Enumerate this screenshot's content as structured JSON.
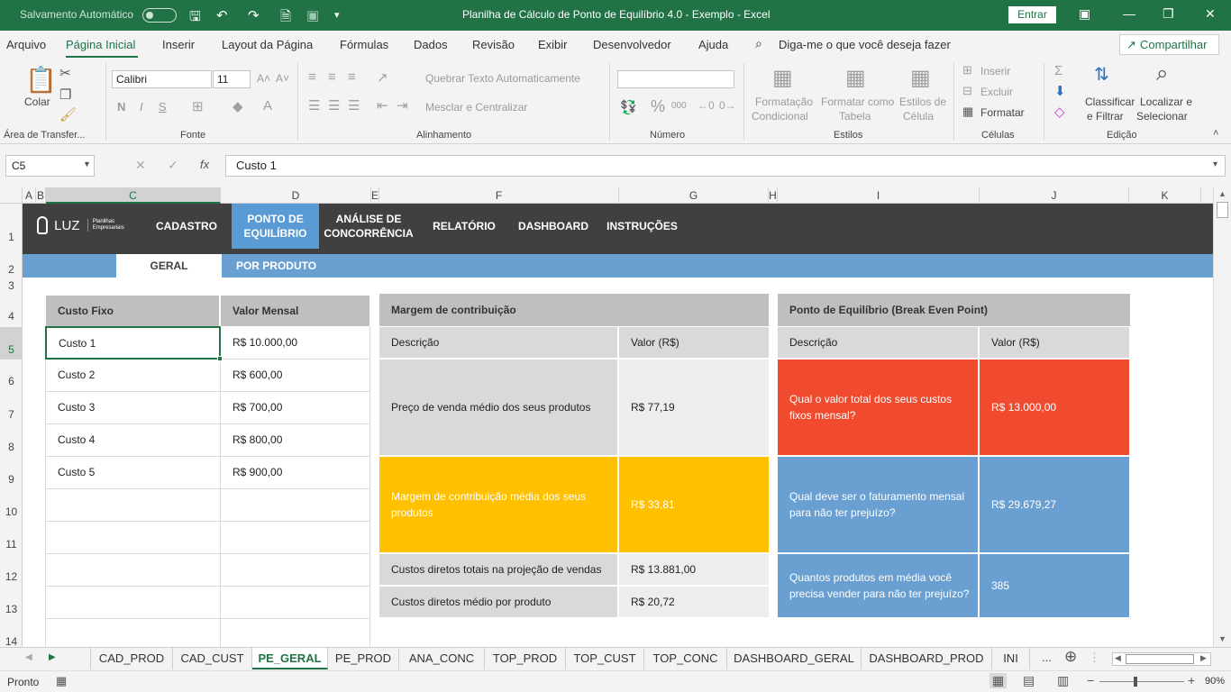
{
  "window": {
    "autosave_label": "Salvamento Automático",
    "title": "Planilha de Cálculo de Ponto de Equilíbrio 4.0 - Exemplo  -  Excel",
    "signin": "Entrar"
  },
  "menu": {
    "items": [
      "Arquivo",
      "Página Inicial",
      "Inserir",
      "Layout da Página",
      "Fórmulas",
      "Dados",
      "Revisão",
      "Exibir",
      "Desenvolvedor",
      "Ajuda"
    ],
    "tellme": "Diga-me o que você deseja fazer",
    "share": "Compartilhar"
  },
  "ribbon": {
    "paste": "Colar",
    "clipboard": "Área de Transfer...",
    "font_name": "Calibri",
    "font_size": "11",
    "font_group": "Fonte",
    "bold": "N",
    "italic": "I",
    "underline": "S",
    "wrap": "Quebrar Texto Automaticamente",
    "merge": "Mesclar e Centralizar",
    "alignment": "Alinhamento",
    "percent": "%",
    "thousands": "000",
    "number": "Número",
    "cond_format": [
      "Formatação",
      "Condicional"
    ],
    "format_table": [
      "Formatar como",
      "Tabela"
    ],
    "cell_styles": [
      "Estilos de",
      "Célula"
    ],
    "styles": "Estilos",
    "insert": "Inserir",
    "delete": "Excluir",
    "format": "Formatar",
    "cells": "Células",
    "sort": [
      "Classificar",
      "e Filtrar"
    ],
    "find": [
      "Localizar e",
      "Selecionar"
    ],
    "editing": "Edição"
  },
  "formula_bar": {
    "name_box": "C5",
    "content": "Custo 1"
  },
  "columns": [
    "A",
    "B",
    "C",
    "D",
    "E",
    "F",
    "G",
    "H",
    "I",
    "J",
    "K"
  ],
  "rows": [
    "1",
    "2",
    "3",
    "4",
    "5",
    "6",
    "7",
    "8",
    "9",
    "10",
    "11",
    "12",
    "13",
    "14"
  ],
  "nav": {
    "logo": "LUZ",
    "logo_sub1": "Planilhas",
    "logo_sub2": "Empresariais",
    "items": [
      {
        "label": "CADASTRO"
      },
      {
        "label": "PONTO DE\nEQUILÍBRIO"
      },
      {
        "label": "ANÁLISE DE\nCONCORRÊNCIA"
      },
      {
        "label": "RELATÓRIO"
      },
      {
        "label": "DASHBOARD"
      },
      {
        "label": "INSTRUÇÕES"
      }
    ],
    "subtabs": [
      "GERAL",
      "POR PRODUTO"
    ]
  },
  "fixed_costs": {
    "header_name": "Custo Fixo",
    "header_value": "Valor Mensal",
    "rows": [
      {
        "name": "Custo 1",
        "value": "R$ 10.000,00"
      },
      {
        "name": "Custo 2",
        "value": "R$ 600,00"
      },
      {
        "name": "Custo 3",
        "value": "R$ 700,00"
      },
      {
        "name": "Custo 4",
        "value": "R$ 800,00"
      },
      {
        "name": "Custo 5",
        "value": "R$ 900,00"
      }
    ]
  },
  "margin": {
    "title": "Margem de contribuição",
    "col_desc": "Descrição",
    "col_value": "Valor (R$)",
    "rows": [
      {
        "desc": "Preço de venda médio dos seus produtos",
        "value": "R$ 77,19"
      },
      {
        "desc": "Margem de contribuição média dos seus produtos",
        "value": "R$ 33,81"
      },
      {
        "desc": "Custos diretos totais na projeção de vendas",
        "value": "R$ 13.881,00"
      },
      {
        "desc": "Custos diretos médio por produto",
        "value": "R$ 20,72"
      }
    ]
  },
  "breakeven": {
    "title": "Ponto de Equilíbrio (Break Even Point)",
    "col_desc": "Descrição",
    "col_value": "Valor (R$)",
    "rows": [
      {
        "desc": "Qual o valor total dos seus custos fixos mensal?",
        "value": "R$ 13.000,00"
      },
      {
        "desc": "Qual deve ser o faturamento mensal para não ter prejuízo?",
        "value": "R$ 29.679,27"
      },
      {
        "desc": "Quantos produtos em média você precisa vender para não ter prejuízo?",
        "value": "385"
      }
    ]
  },
  "sheet_tabs": [
    "CAD_PROD",
    "CAD_CUST",
    "PE_GERAL",
    "PE_PROD",
    "ANA_CONC",
    "TOP_PROD",
    "TOP_CUST",
    "TOP_CONC",
    "DASHBOARD_GERAL",
    "DASHBOARD_PROD",
    "INI"
  ],
  "active_tab": "PE_GERAL",
  "status": {
    "ready": "Pronto",
    "zoom": "90%"
  },
  "colors": {
    "excel_green": "#217346",
    "nav_dark": "#404040",
    "nav_blue": "#5b9bd5",
    "orange": "#ffc000",
    "red": "#f04a2f",
    "blue": "#6a9fd1"
  }
}
